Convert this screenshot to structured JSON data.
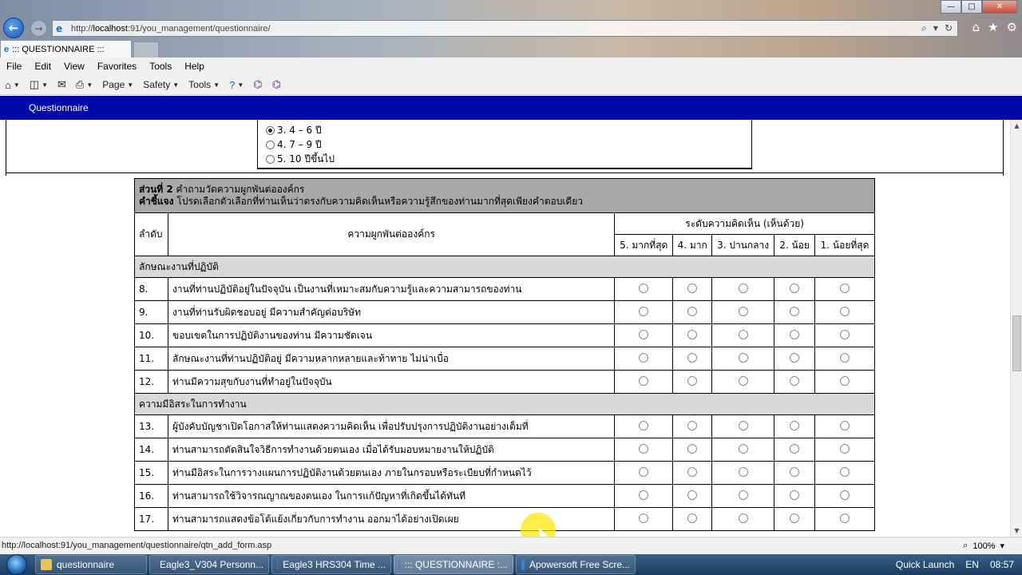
{
  "browser": {
    "url_prefix": "http://",
    "url_host": "localhost",
    "url_rest": ":91/you_management/questionnaire/",
    "tab_title": "::: QUESTIONNAIRE :::",
    "menu": [
      "File",
      "Edit",
      "View",
      "Favorites",
      "Tools",
      "Help"
    ],
    "commands": [
      "Page",
      "Safety",
      "Tools"
    ],
    "status_url": "http://localhost:91/you_management/questionnaire/qtn_add_form.asp",
    "zoom": "100%"
  },
  "app": {
    "header": "Questionnaire"
  },
  "previous_question": {
    "options": [
      {
        "label": "3. 4 – 6 ปี",
        "checked": true
      },
      {
        "label": "4. 7 – 9 ปี",
        "checked": false
      },
      {
        "label": "5. 10 ปีขึ้นไป",
        "checked": false
      }
    ]
  },
  "survey": {
    "part_label": "ส่วนที่ 2",
    "part_title": "คำถามวัดความผูกพันต่อองค์กร",
    "instruction_label": "คำชี้แจง",
    "instruction": "โปรดเลือกตัวเลือกที่ท่านเห็นว่าตรงกับความคิดเห็นหรือความรู้สึกของท่านมากที่สุดเพียงคำตอบเดียว",
    "col_number": "ลำดับ",
    "col_question": "ความผูกพันต่อองค์กร",
    "col_scale": "ระดับความคิดเห็น (เห็นด้วย)",
    "scale": [
      "5. มากที่สุด",
      "4. มาก",
      "3. ปานกลาง",
      "2. น้อย",
      "1. น้อยที่สุด"
    ],
    "sections": [
      {
        "title": "ลักษณะงานที่ปฏิบัติ",
        "items": [
          {
            "num": "8.",
            "text": "งานที่ท่านปฏิบัติอยู่ในปัจจุบัน เป็นงานที่เหมาะสมกับความรู้และความสามารถของท่าน"
          },
          {
            "num": "9.",
            "text": "งานที่ท่านรับผิดชอบอยู่ มีความสำคัญต่อบริษัท"
          },
          {
            "num": "10.",
            "text": "ขอบเขตในการปฏิบัติงานของท่าน มีความชัดเจน"
          },
          {
            "num": "11.",
            "text": "ลักษณะงานที่ท่านปฏิบัติอยู่ มีความหลากหลายและท้าทาย ไม่น่าเบื่อ"
          },
          {
            "num": "12.",
            "text": "ท่านมีความสุขกับงานที่ทำอยู่ในปัจจุบัน"
          }
        ]
      },
      {
        "title": "ความมีอิสระในการทำงาน",
        "items": [
          {
            "num": "13.",
            "text": "ผู้บังคับบัญชาเปิดโอกาสให้ท่านแสดงความคิดเห็น เพื่อปรับปรุงการปฏิบัติงานอย่างเต็มที่"
          },
          {
            "num": "14.",
            "text": "ท่านสามารถตัดสินใจวิธีการทำงานด้วยตนเอง เมื่อได้รับมอบหมายงานให้ปฏิบัติ"
          },
          {
            "num": "15.",
            "text": "ท่านมีอิสระในการวางแผนการปฏิบัติงานด้วยตนเอง ภายในกรอบหรือระเบียบที่กำหนดไว้"
          },
          {
            "num": "16.",
            "text": "ท่านสามารถใช้วิจารณญาณของตนเอง ในการแก้ปัญหาที่เกิดขึ้นได้ทันที"
          },
          {
            "num": "17.",
            "text": "ท่านสามารถแสดงข้อโต้แย้งเกี่ยวกับการทำงาน ออกมาได้อย่างเปิดเผย"
          }
        ]
      }
    ]
  },
  "taskbar": {
    "items": [
      {
        "label": "questionnaire",
        "color": "#e8c25a"
      },
      {
        "label": "Eagle3_V304 Personn...",
        "color": "#c0392b"
      },
      {
        "label": "Eagle3 HRS304 Time ...",
        "color": "#3a7bd5"
      },
      {
        "label": "::: QUESTIONNAIRE :...",
        "color": "#3a7bd5",
        "active": true
      },
      {
        "label": "Apowersoft Free Scre...",
        "color": "#2e86de"
      }
    ],
    "quick_launch": "Quick Launch",
    "language": "EN",
    "time": "08:57"
  }
}
